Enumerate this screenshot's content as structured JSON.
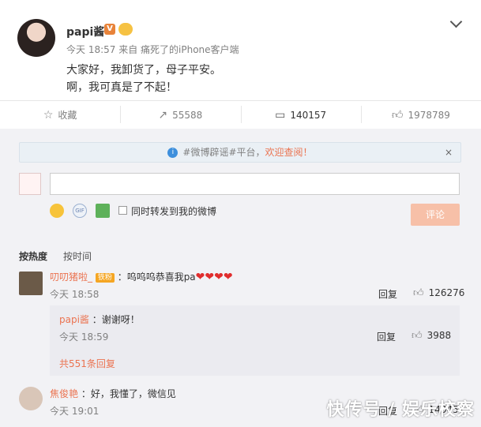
{
  "post": {
    "author": "papi酱",
    "meta": "今天 18:57 来自 痛死了的iPhone客户端",
    "lines": [
      "大家好，我卸货了，母子平安。",
      "啊，我可真是了不起！"
    ]
  },
  "actions": {
    "favorite_label": "收藏",
    "repost_count": "55588",
    "comment_count": "140157",
    "like_count": "1978789"
  },
  "notice": {
    "text": "#微博辟谣#平台，",
    "link": "欢迎查阅！",
    "close": "×"
  },
  "composer": {
    "gif_label": "GIF",
    "forward_label": "同时转发到我的微博",
    "submit_label": "评论"
  },
  "sort": {
    "hot": "按热度",
    "time": "按时间"
  },
  "comments": [
    {
      "user": "叨叨猪啦_",
      "fan_badge": "铁粉",
      "text": "：呜呜呜恭喜我pa",
      "hearts": "❤❤❤❤",
      "time": "今天 18:58",
      "reply_label": "回复",
      "likes": "126276",
      "sub": {
        "user": "papi酱",
        "text": "：谢谢呀！",
        "time": "今天 18:59",
        "reply_label": "回复",
        "likes": "3988",
        "total": "共551条回复"
      }
    },
    {
      "user": "焦俊艳",
      "text": "：好，我懂了，微信见",
      "time": "今天 19:01",
      "reply_label": "回复",
      "likes": "140457"
    }
  ],
  "watermark": "快传号 / 娱乐校察",
  "colors": {
    "accent_orange": "#eb7350",
    "link_blue": "#3d8fdc",
    "submit_disabled": "#f7c0a8"
  }
}
